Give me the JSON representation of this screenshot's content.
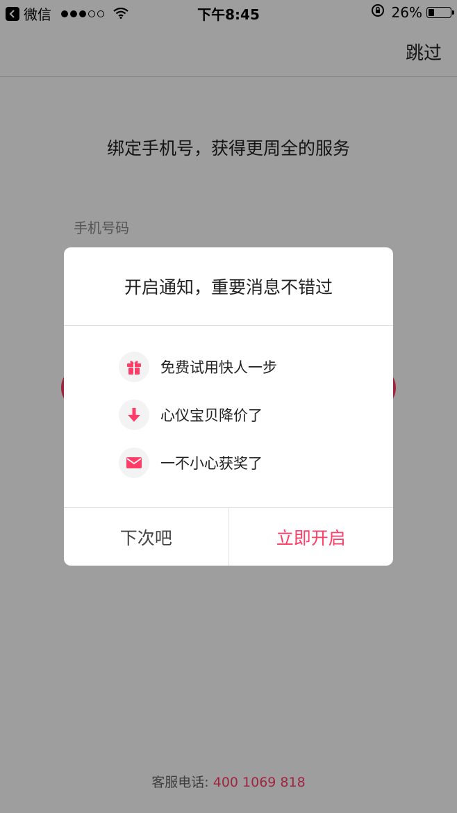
{
  "status_bar": {
    "back_app": "微信",
    "time": "下午8:45",
    "battery": "26%",
    "signal_filled": 3,
    "signal_total": 5,
    "battery_level": 0.26
  },
  "nav": {
    "skip_label": "跳过"
  },
  "page": {
    "headline": "绑定手机号，获得更周全的服务",
    "phone_label": "手机号码",
    "service_label": "客服电话:",
    "service_number": "400 1069 818"
  },
  "dialog": {
    "title": "开启通知，重要消息不错过",
    "features": [
      {
        "icon": "gift-icon",
        "label": "免费试用快人一步"
      },
      {
        "icon": "arrow-down-icon",
        "label": "心仪宝贝降价了"
      },
      {
        "icon": "envelope-icon",
        "label": "一不小心获奖了"
      }
    ],
    "later_label": "下次吧",
    "enable_label": "立即开启"
  },
  "colors": {
    "accent": "#ff3d67",
    "overlay": "rgba(0,0,0,0.38)"
  }
}
